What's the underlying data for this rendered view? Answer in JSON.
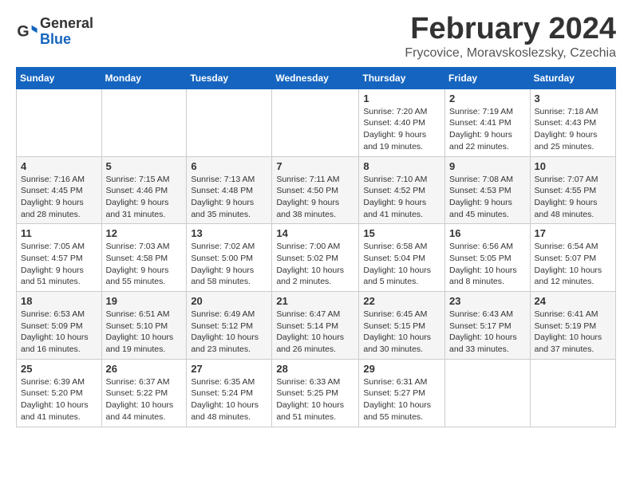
{
  "header": {
    "logo_general": "General",
    "logo_blue": "Blue",
    "month_title": "February 2024",
    "subtitle": "Frycovice, Moravskoslezsky, Czechia"
  },
  "days_of_week": [
    "Sunday",
    "Monday",
    "Tuesday",
    "Wednesday",
    "Thursday",
    "Friday",
    "Saturday"
  ],
  "weeks": [
    [
      {
        "day": "",
        "info": ""
      },
      {
        "day": "",
        "info": ""
      },
      {
        "day": "",
        "info": ""
      },
      {
        "day": "",
        "info": ""
      },
      {
        "day": "1",
        "info": "Sunrise: 7:20 AM\nSunset: 4:40 PM\nDaylight: 9 hours\nand 19 minutes."
      },
      {
        "day": "2",
        "info": "Sunrise: 7:19 AM\nSunset: 4:41 PM\nDaylight: 9 hours\nand 22 minutes."
      },
      {
        "day": "3",
        "info": "Sunrise: 7:18 AM\nSunset: 4:43 PM\nDaylight: 9 hours\nand 25 minutes."
      }
    ],
    [
      {
        "day": "4",
        "info": "Sunrise: 7:16 AM\nSunset: 4:45 PM\nDaylight: 9 hours\nand 28 minutes."
      },
      {
        "day": "5",
        "info": "Sunrise: 7:15 AM\nSunset: 4:46 PM\nDaylight: 9 hours\nand 31 minutes."
      },
      {
        "day": "6",
        "info": "Sunrise: 7:13 AM\nSunset: 4:48 PM\nDaylight: 9 hours\nand 35 minutes."
      },
      {
        "day": "7",
        "info": "Sunrise: 7:11 AM\nSunset: 4:50 PM\nDaylight: 9 hours\nand 38 minutes."
      },
      {
        "day": "8",
        "info": "Sunrise: 7:10 AM\nSunset: 4:52 PM\nDaylight: 9 hours\nand 41 minutes."
      },
      {
        "day": "9",
        "info": "Sunrise: 7:08 AM\nSunset: 4:53 PM\nDaylight: 9 hours\nand 45 minutes."
      },
      {
        "day": "10",
        "info": "Sunrise: 7:07 AM\nSunset: 4:55 PM\nDaylight: 9 hours\nand 48 minutes."
      }
    ],
    [
      {
        "day": "11",
        "info": "Sunrise: 7:05 AM\nSunset: 4:57 PM\nDaylight: 9 hours\nand 51 minutes."
      },
      {
        "day": "12",
        "info": "Sunrise: 7:03 AM\nSunset: 4:58 PM\nDaylight: 9 hours\nand 55 minutes."
      },
      {
        "day": "13",
        "info": "Sunrise: 7:02 AM\nSunset: 5:00 PM\nDaylight: 9 hours\nand 58 minutes."
      },
      {
        "day": "14",
        "info": "Sunrise: 7:00 AM\nSunset: 5:02 PM\nDaylight: 10 hours\nand 2 minutes."
      },
      {
        "day": "15",
        "info": "Sunrise: 6:58 AM\nSunset: 5:04 PM\nDaylight: 10 hours\nand 5 minutes."
      },
      {
        "day": "16",
        "info": "Sunrise: 6:56 AM\nSunset: 5:05 PM\nDaylight: 10 hours\nand 8 minutes."
      },
      {
        "day": "17",
        "info": "Sunrise: 6:54 AM\nSunset: 5:07 PM\nDaylight: 10 hours\nand 12 minutes."
      }
    ],
    [
      {
        "day": "18",
        "info": "Sunrise: 6:53 AM\nSunset: 5:09 PM\nDaylight: 10 hours\nand 16 minutes."
      },
      {
        "day": "19",
        "info": "Sunrise: 6:51 AM\nSunset: 5:10 PM\nDaylight: 10 hours\nand 19 minutes."
      },
      {
        "day": "20",
        "info": "Sunrise: 6:49 AM\nSunset: 5:12 PM\nDaylight: 10 hours\nand 23 minutes."
      },
      {
        "day": "21",
        "info": "Sunrise: 6:47 AM\nSunset: 5:14 PM\nDaylight: 10 hours\nand 26 minutes."
      },
      {
        "day": "22",
        "info": "Sunrise: 6:45 AM\nSunset: 5:15 PM\nDaylight: 10 hours\nand 30 minutes."
      },
      {
        "day": "23",
        "info": "Sunrise: 6:43 AM\nSunset: 5:17 PM\nDaylight: 10 hours\nand 33 minutes."
      },
      {
        "day": "24",
        "info": "Sunrise: 6:41 AM\nSunset: 5:19 PM\nDaylight: 10 hours\nand 37 minutes."
      }
    ],
    [
      {
        "day": "25",
        "info": "Sunrise: 6:39 AM\nSunset: 5:20 PM\nDaylight: 10 hours\nand 41 minutes."
      },
      {
        "day": "26",
        "info": "Sunrise: 6:37 AM\nSunset: 5:22 PM\nDaylight: 10 hours\nand 44 minutes."
      },
      {
        "day": "27",
        "info": "Sunrise: 6:35 AM\nSunset: 5:24 PM\nDaylight: 10 hours\nand 48 minutes."
      },
      {
        "day": "28",
        "info": "Sunrise: 6:33 AM\nSunset: 5:25 PM\nDaylight: 10 hours\nand 51 minutes."
      },
      {
        "day": "29",
        "info": "Sunrise: 6:31 AM\nSunset: 5:27 PM\nDaylight: 10 hours\nand 55 minutes."
      },
      {
        "day": "",
        "info": ""
      },
      {
        "day": "",
        "info": ""
      }
    ]
  ]
}
